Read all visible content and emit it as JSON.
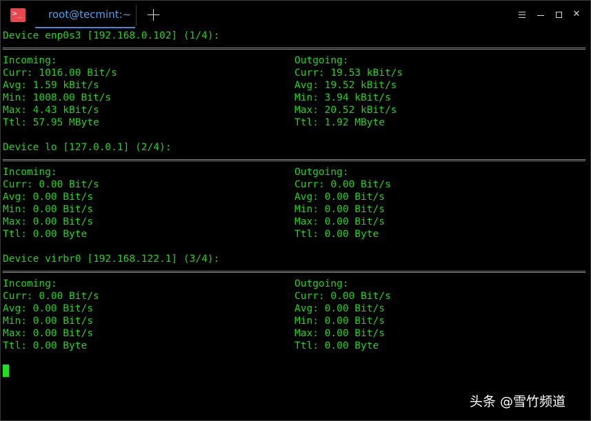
{
  "app_icon": {
    "glyph": ">_",
    "color": "#e7474f"
  },
  "tab": {
    "label": "root@tecmint:~"
  },
  "window_controls": {
    "close": "✕"
  },
  "devices": [
    {
      "header": "Device enp0s3 [192.168.0.102] (1/4):",
      "incoming": {
        "title": "Incoming:",
        "curr": "Curr: 1016.00 Bit/s",
        "avg": "Avg: 1.59 kBit/s",
        "min": "Min: 1008.00 Bit/s",
        "max": "Max: 4.43 kBit/s",
        "ttl": "Ttl: 57.95 MByte"
      },
      "outgoing": {
        "title": "Outgoing:",
        "curr": "Curr: 19.53 kBit/s",
        "avg": "Avg: 19.52 kBit/s",
        "min": "Min: 3.94 kBit/s",
        "max": "Max: 20.52 kBit/s",
        "ttl": "Ttl: 1.92 MByte"
      }
    },
    {
      "header": "Device lo [127.0.0.1] (2/4):",
      "incoming": {
        "title": "Incoming:",
        "curr": "Curr: 0.00 Bit/s",
        "avg": "Avg: 0.00 Bit/s",
        "min": "Min: 0.00 Bit/s",
        "max": "Max: 0.00 Bit/s",
        "ttl": "Ttl: 0.00 Byte"
      },
      "outgoing": {
        "title": "Outgoing:",
        "curr": "Curr: 0.00 Bit/s",
        "avg": "Avg: 0.00 Bit/s",
        "min": "Min: 0.00 Bit/s",
        "max": "Max: 0.00 Bit/s",
        "ttl": "Ttl: 0.00 Byte"
      }
    },
    {
      "header": "Device virbr0 [192.168.122.1] (3/4):",
      "incoming": {
        "title": "Incoming:",
        "curr": "Curr: 0.00 Bit/s",
        "avg": "Avg: 0.00 Bit/s",
        "min": "Min: 0.00 Bit/s",
        "max": "Max: 0.00 Bit/s",
        "ttl": "Ttl: 0.00 Byte"
      },
      "outgoing": {
        "title": "Outgoing:",
        "curr": "Curr: 0.00 Bit/s",
        "avg": "Avg: 0.00 Bit/s",
        "min": "Min: 0.00 Bit/s",
        "max": "Max: 0.00 Bit/s",
        "ttl": "Ttl: 0.00 Byte"
      }
    }
  ],
  "colors": {
    "terminal_text": "#23d11f",
    "background": "#000000",
    "tab_accent": "#3d8bd8"
  },
  "watermark": "头条 @雪竹频道"
}
